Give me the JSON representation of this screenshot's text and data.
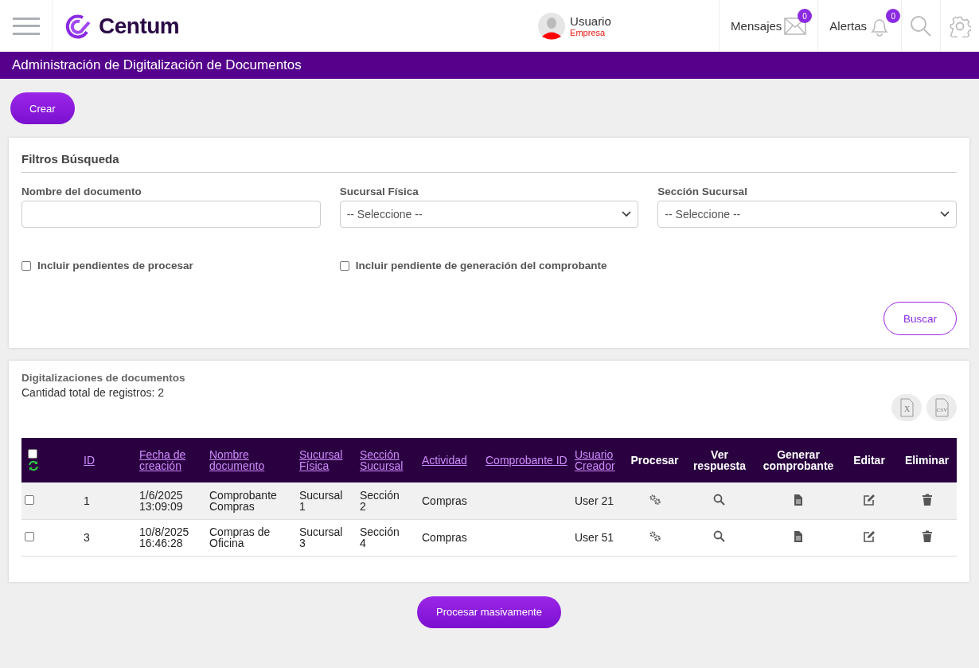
{
  "header": {
    "brand": "Centum",
    "user": {
      "name": "Usuario",
      "company": "Empresa"
    },
    "messages": {
      "label": "Mensajes",
      "count": "0"
    },
    "alerts": {
      "label": "Alertas",
      "count": "0"
    }
  },
  "page_title": "Administración de Digitalización de Documentos",
  "create_button": "Crear",
  "filters": {
    "title": "Filtros Búsqueda",
    "fields": [
      {
        "kind": "text",
        "label": "Nombre del documento"
      },
      {
        "kind": "select",
        "label": "Sucursal Física",
        "value": "-- Seleccione --"
      },
      {
        "kind": "select",
        "label": "Sección Sucursal",
        "value": "-- Seleccione --"
      }
    ],
    "checkboxes": [
      {
        "label": "Incluir pendientes de procesar",
        "checked": false
      },
      {
        "label": "Incluir pendiente de generación del comprobante",
        "checked": false
      }
    ],
    "search_button": "Buscar"
  },
  "results": {
    "title": "Digitalizaciones de documentos",
    "count_text": "Cantidad total de registros: 2",
    "export_buttons": [
      {
        "label": "X"
      },
      {
        "label": "CSV"
      }
    ],
    "select_all_checked": false,
    "columns": [
      {
        "label": "ID",
        "sortable": true
      },
      {
        "label": "Fecha de creación",
        "sortable": true
      },
      {
        "label": "Nombre documento",
        "sortable": true
      },
      {
        "label": "Sucursal Física",
        "sortable": true
      },
      {
        "label": "Sección Sucursal",
        "sortable": true
      },
      {
        "label": "Actividad",
        "sortable": true
      },
      {
        "label": "Comprobante ID",
        "sortable": true
      },
      {
        "label": "Usuario Creador",
        "sortable": true
      },
      {
        "label": "Procesar",
        "sortable": false
      },
      {
        "label": "Ver respuesta",
        "sortable": false
      },
      {
        "label": "Generar comprobante",
        "sortable": false
      },
      {
        "label": "Editar",
        "sortable": false
      },
      {
        "label": "Eliminar",
        "sortable": false
      }
    ],
    "rows": [
      {
        "checked": false,
        "cells": [
          "1",
          "1/6/2025 13:09:09",
          "Comprobante Compras",
          "Sucursal 1",
          "Sección 2",
          "Compras",
          "",
          "User 21"
        ]
      },
      {
        "checked": false,
        "cells": [
          "3",
          "10/8/2025 16:46:28",
          "Compras de Oficina",
          "Sucursal 3",
          "Sección 4",
          "Compras",
          "",
          "User 51"
        ]
      }
    ]
  },
  "bulk_button": "Procesar masivamente"
}
